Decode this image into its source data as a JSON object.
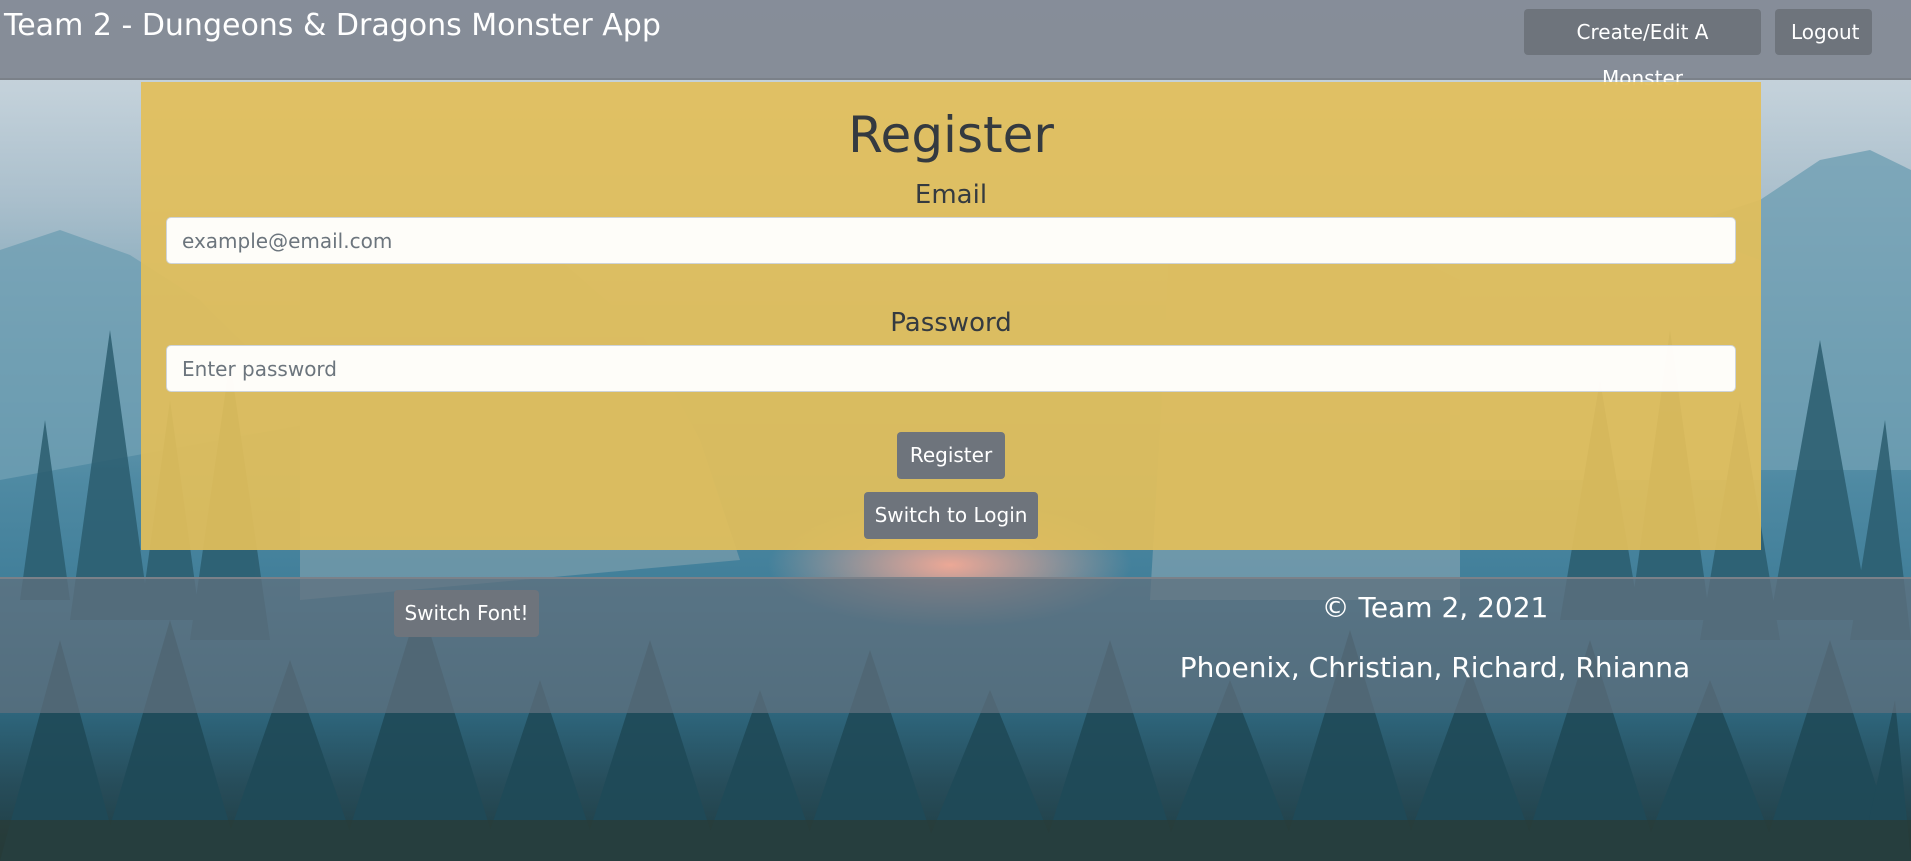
{
  "navbar": {
    "brand": "Team 2 - Dungeons & Dragons Monster App",
    "create_label": "Create/Edit A Monster",
    "logout_label": "Logout"
  },
  "register": {
    "title": "Register",
    "email_label": "Email",
    "email_placeholder": "example@email.com",
    "email_value": "",
    "password_label": "Password",
    "password_placeholder": "Enter password",
    "password_value": "",
    "register_label": "Register",
    "switch_label": "Switch to Login"
  },
  "footer": {
    "switch_font_label": "Switch Font!",
    "copyright": "© Team 2, 2021",
    "credits": "Phoenix, Christian, Richard, Rhianna"
  },
  "colors": {
    "navbar_bg": "#808792",
    "panel_bg": "#e2be5a",
    "button_bg": "#6e747c",
    "footer_bg": "#60707e",
    "text_dark": "#343a40"
  }
}
